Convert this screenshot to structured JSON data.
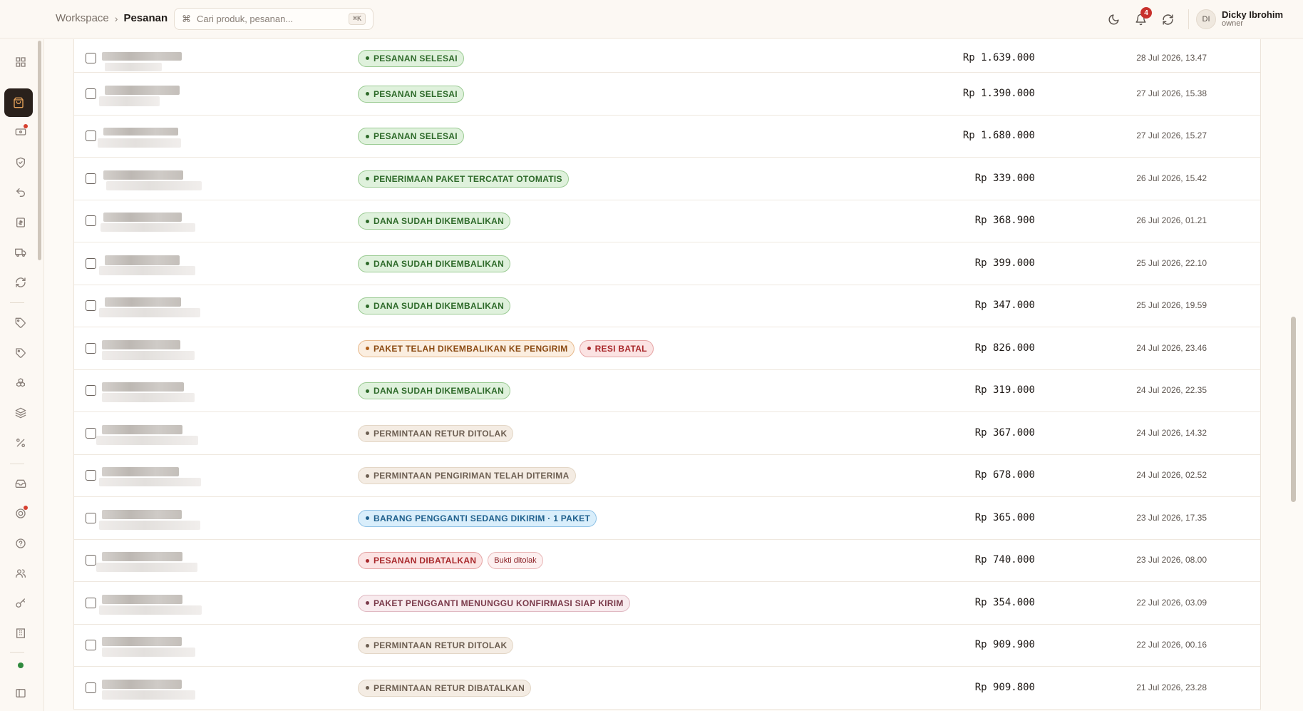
{
  "breadcrumb": {
    "parent": "Workspace",
    "current": "Pesanan"
  },
  "search": {
    "placeholder": "Cari produk, pesanan...",
    "shortcut": "⌘K"
  },
  "notifications": {
    "count": "4"
  },
  "user": {
    "initials": "DI",
    "name": "Dicky Ibrohim",
    "role": "owner"
  },
  "sidebar": {
    "items": [
      {
        "name": "dashboard-icon"
      },
      {
        "name": "orders-icon",
        "active": true
      },
      {
        "name": "payments-icon",
        "dot": true
      },
      {
        "name": "shield-icon"
      },
      {
        "name": "return-icon"
      },
      {
        "name": "invoice-icon"
      },
      {
        "name": "truck-icon"
      },
      {
        "name": "sync-icon"
      },
      {
        "name": "tag-icon"
      },
      {
        "name": "tags-icon"
      },
      {
        "name": "boxes-icon"
      },
      {
        "name": "layers-icon"
      },
      {
        "name": "percent-icon"
      },
      {
        "name": "inbox-icon"
      },
      {
        "name": "support-icon",
        "dot": true
      },
      {
        "name": "help-icon"
      },
      {
        "name": "users-icon"
      },
      {
        "name": "key-icon"
      },
      {
        "name": "store-icon"
      },
      {
        "name": "sidebar-toggle-icon"
      }
    ]
  },
  "orders": [
    {
      "badges": [
        {
          "text": "PESANAN SELESAI",
          "tone": "green"
        }
      ],
      "amount": "Rp 1.639.000",
      "date": "28 Jul 2026, 13.47"
    },
    {
      "badges": [
        {
          "text": "PESANAN SELESAI",
          "tone": "green"
        }
      ],
      "amount": "Rp 1.390.000",
      "date": "27 Jul 2026, 15.38"
    },
    {
      "badges": [
        {
          "text": "PESANAN SELESAI",
          "tone": "green"
        }
      ],
      "amount": "Rp 1.680.000",
      "date": "27 Jul 2026, 15.27"
    },
    {
      "badges": [
        {
          "text": "PENERIMAAN PAKET TERCATAT OTOMATIS",
          "tone": "green"
        }
      ],
      "amount": "Rp 339.000",
      "date": "26 Jul 2026, 15.42"
    },
    {
      "badges": [
        {
          "text": "DANA SUDAH DIKEMBALIKAN",
          "tone": "green"
        }
      ],
      "amount": "Rp 368.900",
      "date": "26 Jul 2026, 01.21"
    },
    {
      "badges": [
        {
          "text": "DANA SUDAH DIKEMBALIKAN",
          "tone": "green"
        }
      ],
      "amount": "Rp 399.000",
      "date": "25 Jul 2026, 22.10"
    },
    {
      "badges": [
        {
          "text": "DANA SUDAH DIKEMBALIKAN",
          "tone": "green"
        }
      ],
      "amount": "Rp 347.000",
      "date": "25 Jul 2026, 19.59"
    },
    {
      "badges": [
        {
          "text": "PAKET TELAH DIKEMBALIKAN KE PENGIRIM",
          "tone": "orange"
        },
        {
          "text": "RESI BATAL",
          "tone": "red"
        }
      ],
      "amount": "Rp 826.000",
      "date": "24 Jul 2026, 23.46"
    },
    {
      "badges": [
        {
          "text": "DANA SUDAH DIKEMBALIKAN",
          "tone": "green"
        }
      ],
      "amount": "Rp 319.000",
      "date": "24 Jul 2026, 22.35"
    },
    {
      "badges": [
        {
          "text": "PERMINTAAN RETUR DITOLAK",
          "tone": "beige"
        }
      ],
      "amount": "Rp 367.000",
      "date": "24 Jul 2026, 14.32"
    },
    {
      "badges": [
        {
          "text": "PERMINTAAN PENGIRIMAN TELAH DITERIMA",
          "tone": "beige"
        }
      ],
      "amount": "Rp 678.000",
      "date": "24 Jul 2026, 02.52"
    },
    {
      "badges": [
        {
          "text": "BARANG PENGGANTI SEDANG DIKIRIM · 1 PAKET",
          "tone": "blue"
        }
      ],
      "amount": "Rp 365.000",
      "date": "23 Jul 2026, 17.35"
    },
    {
      "badges": [
        {
          "text": "PESANAN DIBATALKAN",
          "tone": "red"
        },
        {
          "text": "Bukti ditolak",
          "tone": "tag"
        }
      ],
      "amount": "Rp 740.000",
      "date": "23 Jul 2026, 08.00"
    },
    {
      "badges": [
        {
          "text": "PAKET PENGGANTI MENUNGGU KONFIRMASI SIAP KIRIM",
          "tone": "pink"
        }
      ],
      "amount": "Rp 354.000",
      "date": "22 Jul 2026, 03.09"
    },
    {
      "badges": [
        {
          "text": "PERMINTAAN RETUR DITOLAK",
          "tone": "beige"
        }
      ],
      "amount": "Rp 909.900",
      "date": "22 Jul 2026, 00.16"
    },
    {
      "badges": [
        {
          "text": "PERMINTAAN RETUR DIBATALKAN",
          "tone": "beige"
        }
      ],
      "amount": "Rp 909.800",
      "date": "21 Jul 2026, 23.28"
    }
  ]
}
